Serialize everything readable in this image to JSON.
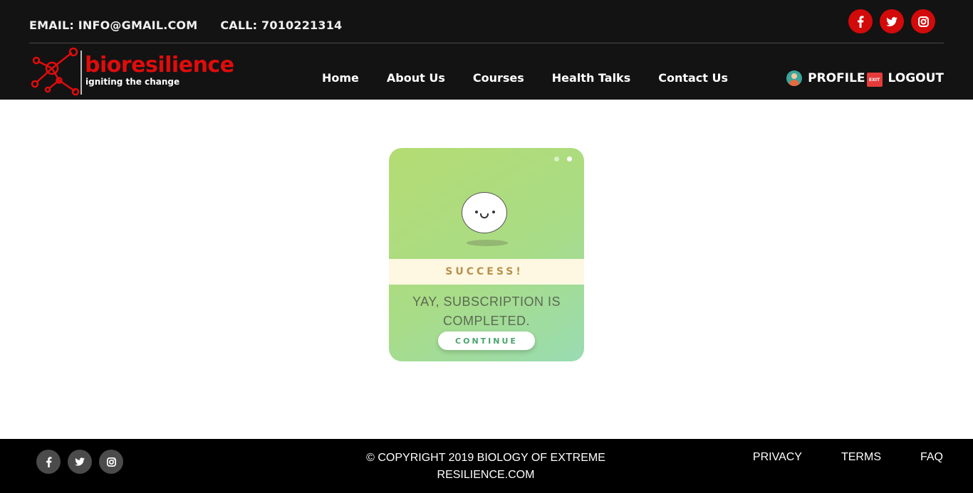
{
  "header": {
    "email": "EMAIL: INFO@GMAIL.COM",
    "phone": "CALL: 7010221314",
    "social": [
      "facebook-icon",
      "twitter-icon",
      "instagram-icon"
    ],
    "logo": {
      "word": "bioresilience",
      "tagline": "igniting the change"
    },
    "nav": [
      "Home",
      "About Us",
      "Courses",
      "Health Talks",
      "Contact Us"
    ],
    "profile_label": "PROFILE",
    "logout_label": "LOGOUT",
    "exit_icon_text": "EXIT"
  },
  "card": {
    "status": "SUCCESS!",
    "message": "YAY, SUBSCRIPTION IS COMPLETED.",
    "button": "CONTINUE"
  },
  "footer": {
    "copyright": "© COPYRIGHT 2019 BIOLOGY OF EXTREME RESILIENCE.COM",
    "links": [
      "PRIVACY",
      "TERMS",
      "FAQ"
    ]
  },
  "colors": {
    "header_bg": "#131313",
    "brand_red": "#e00c0c",
    "social_red": "#d30a0a",
    "card_green": "#b4dc73",
    "success_text": "#b8904c",
    "footer_bg": "#000000"
  }
}
